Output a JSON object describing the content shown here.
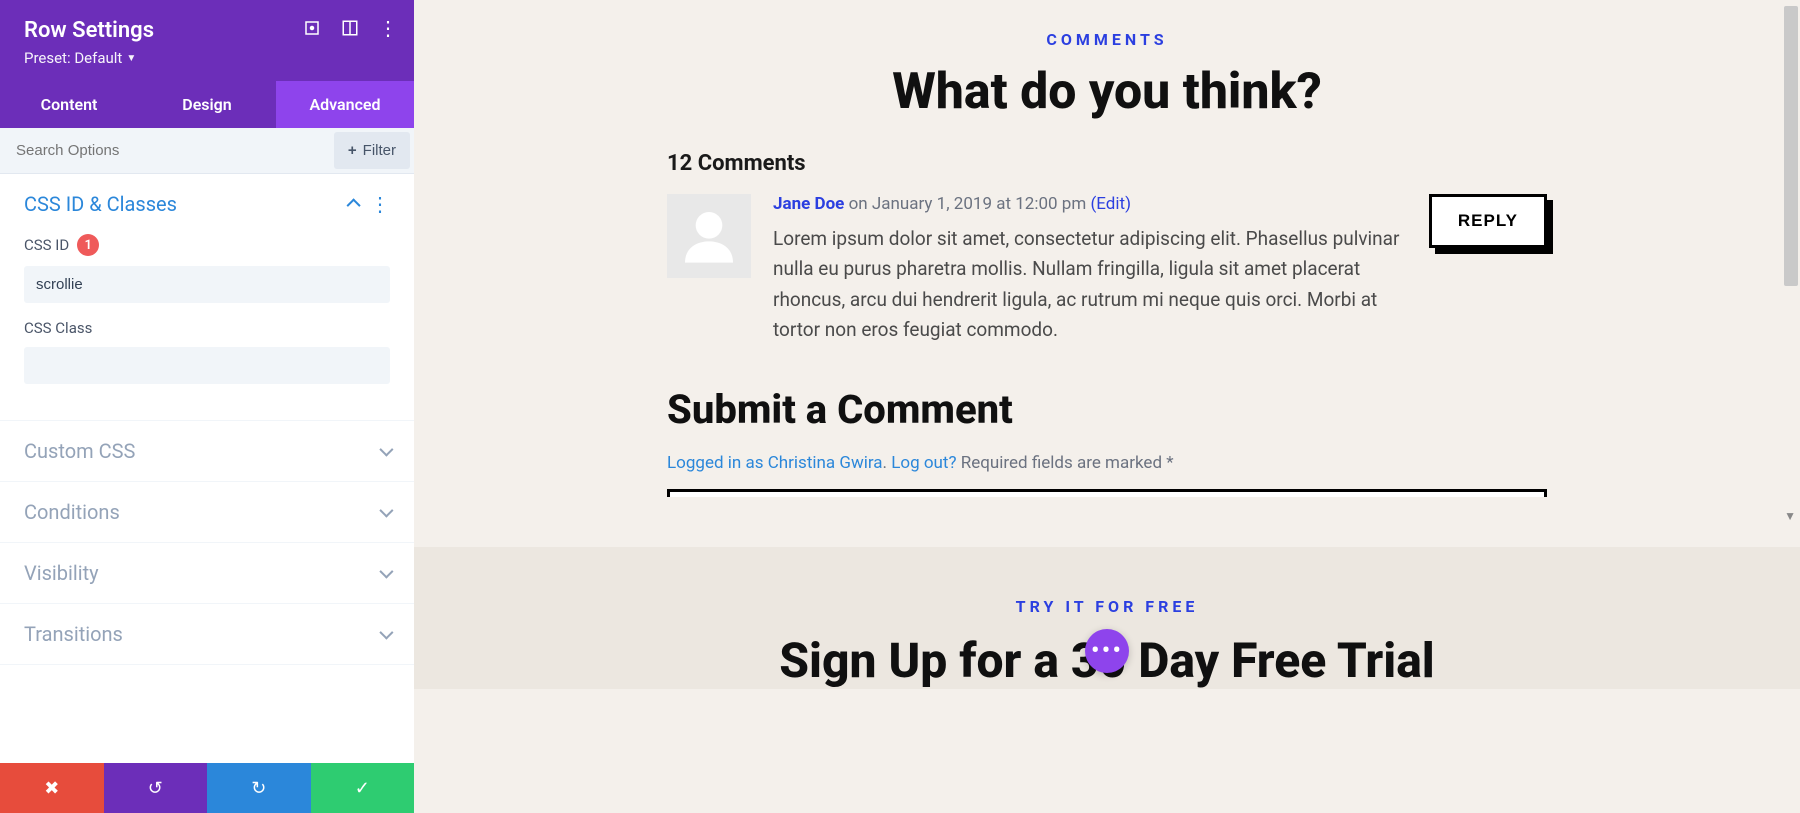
{
  "sidebar": {
    "title": "Row Settings",
    "preset": "Preset: Default",
    "tabs": {
      "content": "Content",
      "design": "Design",
      "advanced": "Advanced"
    },
    "search_placeholder": "Search Options",
    "filter_label": "Filter",
    "sections": {
      "css_id_classes": {
        "title": "CSS ID & Classes",
        "css_id_label": "CSS ID",
        "css_id_badge": "1",
        "css_id_value": "scrollie",
        "css_class_label": "CSS Class",
        "css_class_value": ""
      },
      "custom_css": "Custom CSS",
      "conditions": "Conditions",
      "visibility": "Visibility",
      "transitions": "Transitions"
    }
  },
  "preview": {
    "comments_label": "COMMENTS",
    "comments_heading": "What do you think?",
    "comments_count": "12 Comments",
    "comment": {
      "author": "Jane Doe",
      "date": "on January 1, 2019 at 12:00 pm",
      "edit": "(Edit)",
      "text": "Lorem ipsum dolor sit amet, consectetur adipiscing elit. Phasellus pulvinar nulla eu purus pharetra mollis. Nullam fringilla, ligula sit amet placerat rhoncus, arcu dui hendrerit ligula, ac rutrum mi neque quis orci. Morbi at tortor non eros feugiat commodo.",
      "reply": "REPLY"
    },
    "submit": {
      "heading": "Submit a Comment",
      "logged_in": "Logged in as Christina Gwira",
      "logout": "Log out?",
      "required": "Required fields are marked *",
      "sep": ". "
    },
    "trial": {
      "label": "TRY IT FOR FREE",
      "heading": "Sign Up for a 30 Day Free Trial"
    }
  }
}
